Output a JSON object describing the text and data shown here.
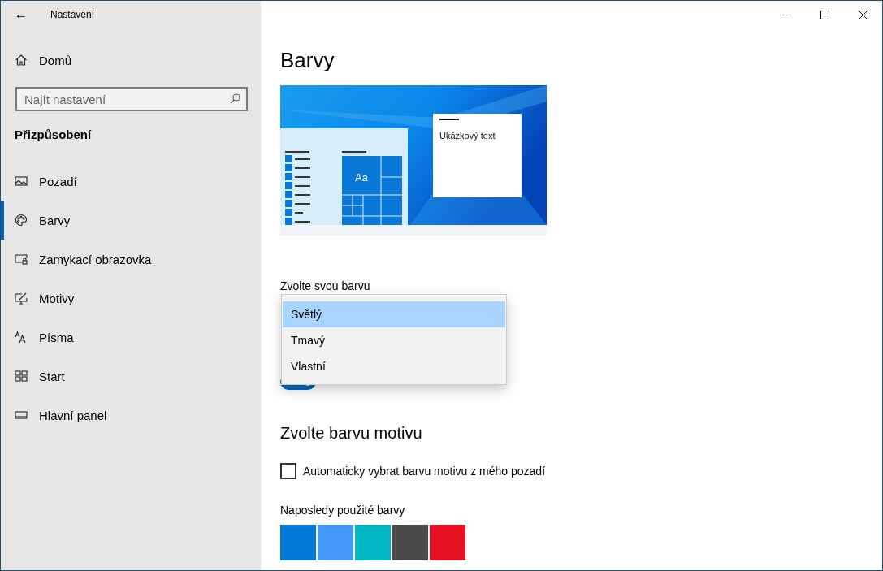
{
  "window": {
    "title": "Nastavení",
    "back": "←"
  },
  "sidebar": {
    "home": "Domů",
    "search": {
      "placeholder": "Najít nastavení"
    },
    "section": "Přizpůsobení",
    "items": [
      {
        "label": "Pozadí",
        "selected": false
      },
      {
        "label": "Barvy",
        "selected": true
      },
      {
        "label": "Zamykací obrazovka",
        "selected": false
      },
      {
        "label": "Motivy",
        "selected": false
      },
      {
        "label": "Písma",
        "selected": false
      },
      {
        "label": "Start",
        "selected": false
      },
      {
        "label": "Hlavní panel",
        "selected": false
      }
    ]
  },
  "page": {
    "title": "Barvy",
    "preview": {
      "sample_text": "Ukázkový text",
      "tile_label": "Aa"
    },
    "color_choice": {
      "label": "Zvolte svou barvu",
      "options": [
        {
          "label": "Světlý",
          "selected": true
        },
        {
          "label": "Tmavý",
          "selected": false
        },
        {
          "label": "Vlastní",
          "selected": false
        }
      ]
    },
    "transparency": {
      "on": true
    },
    "accent": {
      "heading": "Zvolte barvu motivu",
      "auto": {
        "label": "Automaticky vybrat barvu motivu z mého pozadí",
        "checked": false
      },
      "recent_label": "Naposledy použité barvy",
      "recent_colors": [
        {
          "color": "#0078d7"
        },
        {
          "color": "#4399fa"
        },
        {
          "color": "#00b7c3"
        },
        {
          "color": "#4c4a48"
        },
        {
          "color": "#e81123"
        }
      ]
    }
  }
}
